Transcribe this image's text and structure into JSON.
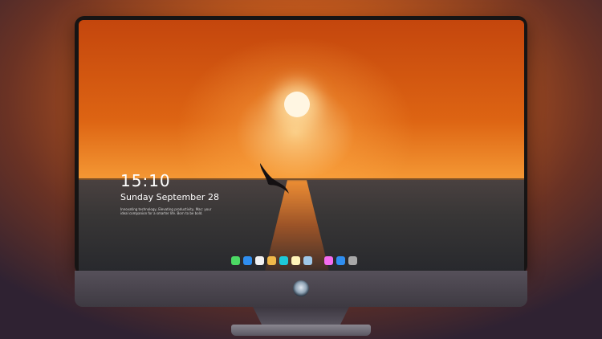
{
  "lock_screen": {
    "time": "15:10",
    "date": "Sunday September 28",
    "tagline": "Innovating technology, Elevating productivity, Mac: your ideal companion for a smarter life. Born to be bold."
  },
  "dock": {
    "apps": [
      {
        "name": "messages-icon",
        "color": "#4cd964"
      },
      {
        "name": "finder-icon",
        "color": "#2f8ef0"
      },
      {
        "name": "clock-icon",
        "color": "#f2f2f2"
      },
      {
        "name": "photos-icon",
        "color": "#f0b84a"
      },
      {
        "name": "claquette-icon",
        "color": "#1ec8d8"
      },
      {
        "name": "notes-icon",
        "color": "#fff4b8"
      },
      {
        "name": "preview-icon",
        "color": "#9fc7e8"
      },
      {
        "name": "music-icon",
        "color": "#f46cf0"
      },
      {
        "name": "app-store-icon",
        "color": "#2f8ef0"
      },
      {
        "name": "wallet-icon",
        "color": "#a8a8a8"
      }
    ]
  },
  "colors": {
    "sky_top": "#c4460d",
    "sun": "#fff6e2",
    "sea": "#383636"
  }
}
